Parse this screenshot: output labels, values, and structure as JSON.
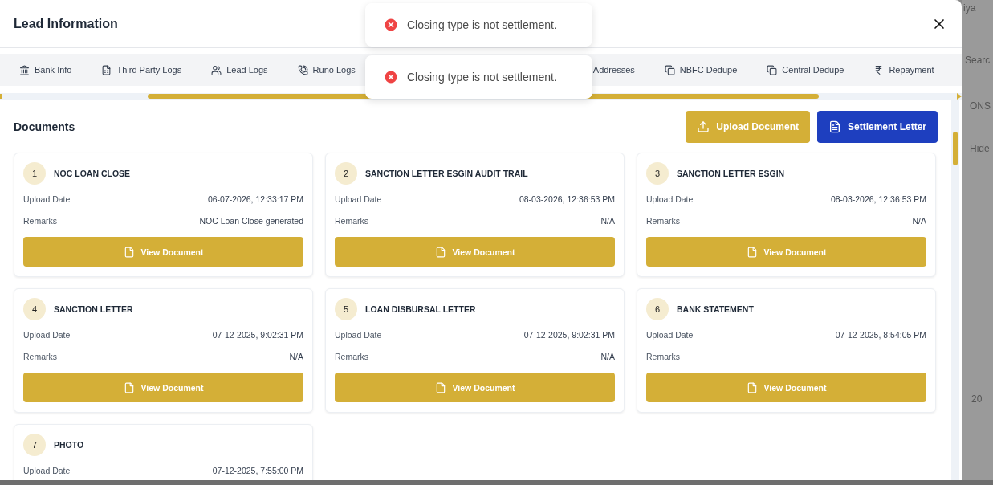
{
  "backdrop": {
    "texts": [
      "iya",
      "Searc",
      "ONS",
      "Hide",
      "20"
    ]
  },
  "modal": {
    "title": "Lead Information"
  },
  "tabs": [
    {
      "label": "Bank Info"
    },
    {
      "label": "Third Party Logs"
    },
    {
      "label": "Lead Logs"
    },
    {
      "label": "Runo Logs"
    },
    {
      "label": "Addresses"
    },
    {
      "label": "NBFC Dedupe"
    },
    {
      "label": "Central Dedupe"
    },
    {
      "label": "Repayment"
    }
  ],
  "toasts": [
    {
      "message": "Closing type is not settlement."
    },
    {
      "message": "Closing type is not settlement."
    }
  ],
  "documents": {
    "title": "Documents",
    "upload_button": "Upload Document",
    "settlement_button": "Settlement Letter",
    "items": [
      {
        "index": "1",
        "name": "NOC LOAN CLOSE",
        "date_label": "Upload Date",
        "date": "06-07-2026, 12:33:17 PM",
        "remarks_label": "Remarks",
        "remarks": "NOC Loan Close generated",
        "button": "View Document"
      },
      {
        "index": "2",
        "name": "SANCTION LETTER ESGIN AUDIT TRAIL",
        "date_label": "Upload Date",
        "date": "08-03-2026, 12:36:53 PM",
        "remarks_label": "Remarks",
        "remarks": "N/A",
        "button": "View Document"
      },
      {
        "index": "3",
        "name": "SANCTION LETTER ESGIN",
        "date_label": "Upload Date",
        "date": "08-03-2026, 12:36:53 PM",
        "remarks_label": "Remarks",
        "remarks": "N/A",
        "button": "View Document"
      },
      {
        "index": "4",
        "name": "SANCTION LETTER",
        "date_label": "Upload Date",
        "date": "07-12-2025, 9:02:31 PM",
        "remarks_label": "Remarks",
        "remarks": "N/A",
        "button": "View Document"
      },
      {
        "index": "5",
        "name": "LOAN DISBURSAL LETTER",
        "date_label": "Upload Date",
        "date": "07-12-2025, 9:02:31 PM",
        "remarks_label": "Remarks",
        "remarks": "N/A",
        "button": "View Document"
      },
      {
        "index": "6",
        "name": "BANK STATEMENT",
        "date_label": "Upload Date",
        "date": "07-12-2025, 8:54:05 PM",
        "remarks_label": "Remarks",
        "button": "View Document"
      },
      {
        "index": "7",
        "name": "PHOTO",
        "date_label": "Upload Date",
        "date": "07-12-2025, 7:55:00 PM"
      }
    ]
  }
}
